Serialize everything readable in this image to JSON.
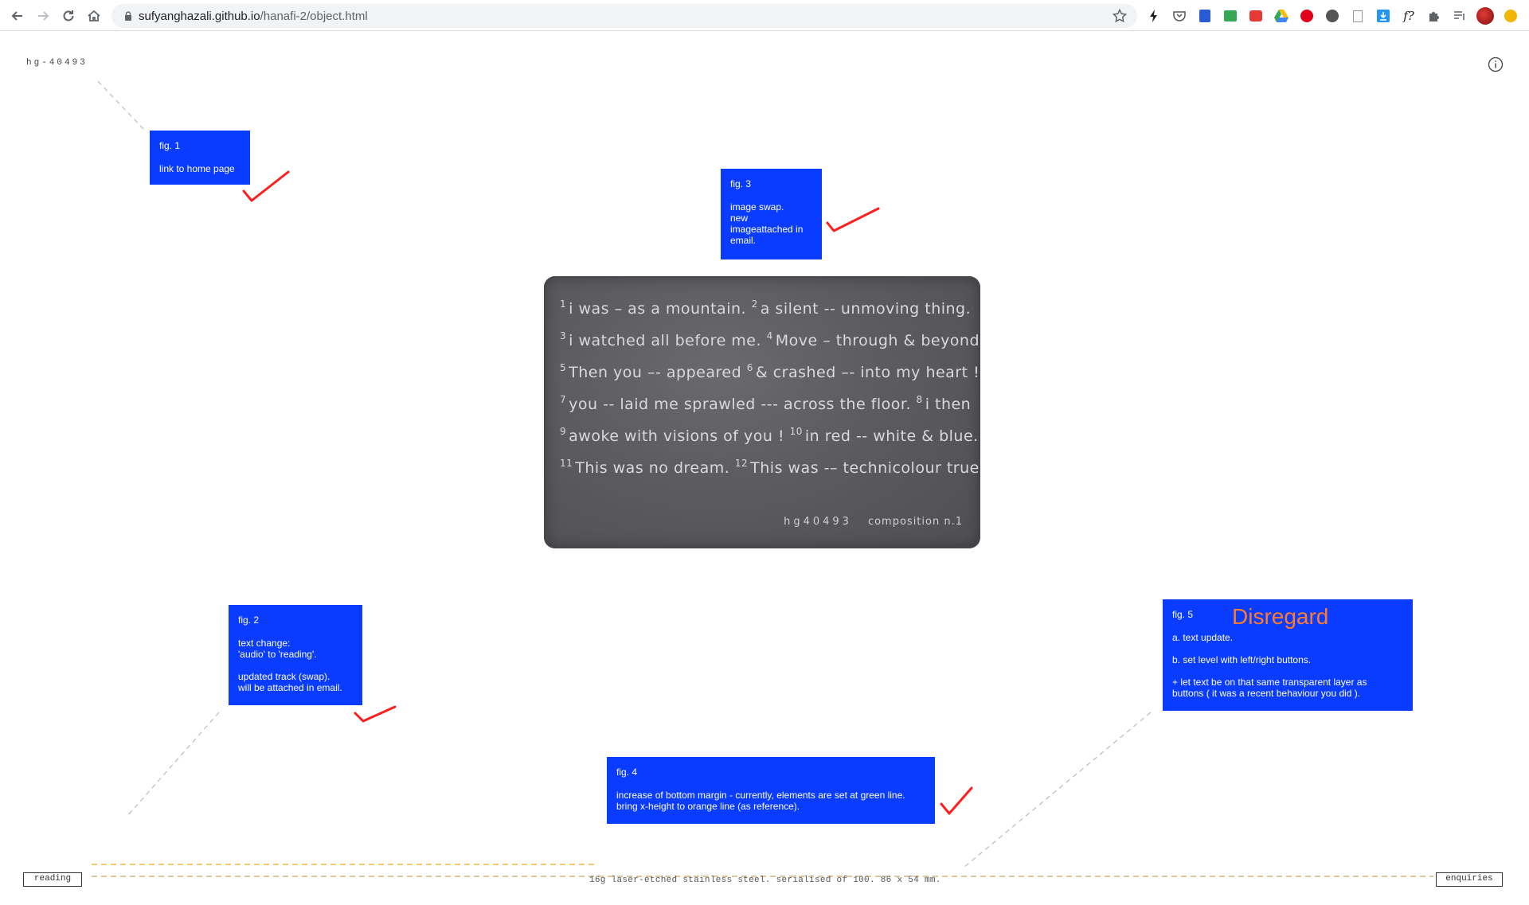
{
  "browser": {
    "url_host": "sufyanghazali.github.io",
    "url_path": "/hanafi-2/object.html",
    "nav": [
      "back-icon",
      "forward-icon",
      "reload-icon",
      "home-icon"
    ],
    "extensions": [
      "bolt-icon",
      "pocket-icon",
      "reader-icon",
      "print-icon",
      "video-icon",
      "drive-icon",
      "opera-icon",
      "skull-icon",
      "doc-icon",
      "download-icon",
      "font-icon",
      "puzzle-icon",
      "queue-icon",
      "profile-avatar",
      "notification-icon"
    ]
  },
  "page": {
    "serial_top": "hg-40493",
    "notes": [
      {
        "fig": "fig. 1",
        "lines": [
          "link to home page"
        ]
      },
      {
        "fig": "fig. 2",
        "lines": [
          "text change:",
          "'audio' to 'reading'.",
          "",
          "updated track (swap).",
          "will be attached in email."
        ]
      },
      {
        "fig": "fig. 3",
        "lines": [
          "image swap.",
          "new",
          "imageattached in",
          "email."
        ]
      },
      {
        "fig": "fig. 4",
        "lines": [
          "increase of bottom margin - currently, elements are set at green line.",
          "bring x-height to orange line (as reference)."
        ]
      },
      {
        "fig": "fig. 5",
        "heading": "Disregard",
        "lines": [
          "a. text update.",
          "",
          "b. set level with left/right buttons.",
          "",
          "+ let text be on that same transparent layer as",
          "buttons ( it was a recent behaviour you did )."
        ]
      }
    ],
    "card": {
      "lines": [
        [
          {
            "n": "1",
            "t": "i was – as a mountain."
          },
          {
            "n": "2",
            "t": "a silent -- unmoving thing."
          }
        ],
        [
          {
            "n": "3",
            "t": "i watched all before me."
          },
          {
            "n": "4",
            "t": "Move – through & beyond."
          }
        ],
        [
          {
            "n": "5",
            "t": "Then you –- appeared"
          },
          {
            "n": "6",
            "t": "& crashed –- into my heart !"
          }
        ],
        [
          {
            "n": "7",
            "t": "you -- laid me sprawled --- across the floor."
          },
          {
            "n": "8",
            "t": "i then"
          }
        ],
        [
          {
            "n": "9",
            "t": "awoke with visions of you !"
          },
          {
            "n": "10",
            "t": "in red -- white & blue."
          }
        ],
        [
          {
            "n": "11",
            "t": "This was no dream."
          },
          {
            "n": "12",
            "t": "This was -– technicolour true."
          }
        ]
      ],
      "serial": "hg40493",
      "title": "composition n.1"
    },
    "footer": {
      "left_button": "reading",
      "right_button": "enquiries",
      "caption": "16g laser-etched stainless steel. serialised of 100. 86 x 54 mm."
    },
    "colors": {
      "note_blue": "#0a3cff",
      "check_red": "#ff1e1e",
      "guide_orange": "#f5a623",
      "disregard_orange": "#ff7a2a"
    }
  }
}
